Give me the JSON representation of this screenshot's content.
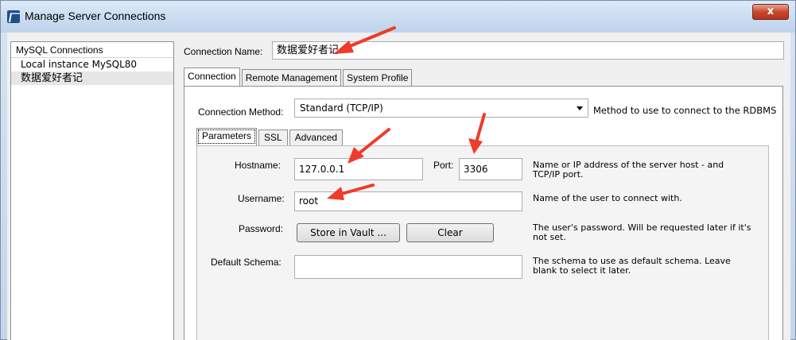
{
  "window": {
    "title": "Manage Server Connections",
    "close_label": "x"
  },
  "sidebar": {
    "header": "MySQL Connections",
    "items": [
      {
        "label": "Local instance MySQL80"
      },
      {
        "label": "数据爱好者记"
      }
    ]
  },
  "connection_name": {
    "label": "Connection Name:",
    "value": "数据爱好者记"
  },
  "tabs": [
    {
      "label": "Connection"
    },
    {
      "label": "Remote Management"
    },
    {
      "label": "System Profile"
    }
  ],
  "connection_method": {
    "label": "Connection Method:",
    "value": "Standard (TCP/IP)",
    "help": "Method to use to connect to the RDBMS"
  },
  "inner_tabs": [
    {
      "label": "Parameters"
    },
    {
      "label": "SSL"
    },
    {
      "label": "Advanced"
    }
  ],
  "params": {
    "hostname": {
      "label": "Hostname:",
      "value": "127.0.0.1"
    },
    "port": {
      "label": "Port:",
      "value": "3306"
    },
    "host_help_1": "Name or IP address of the server host - and",
    "host_help_2": "TCP/IP port.",
    "username": {
      "label": "Username:",
      "value": "root",
      "help": "Name of the user to connect with."
    },
    "password": {
      "label": "Password:",
      "store_label": "Store in Vault ...",
      "clear_label": "Clear",
      "help_1": "The user's password. Will be requested later if it's",
      "help_2": "not set."
    },
    "schema": {
      "label": "Default Schema:",
      "value": "",
      "help_1": "The schema to use as default schema. Leave",
      "help_2": "blank to select it later."
    }
  },
  "colors": {
    "annotation_arrow": "#f03a2a"
  }
}
